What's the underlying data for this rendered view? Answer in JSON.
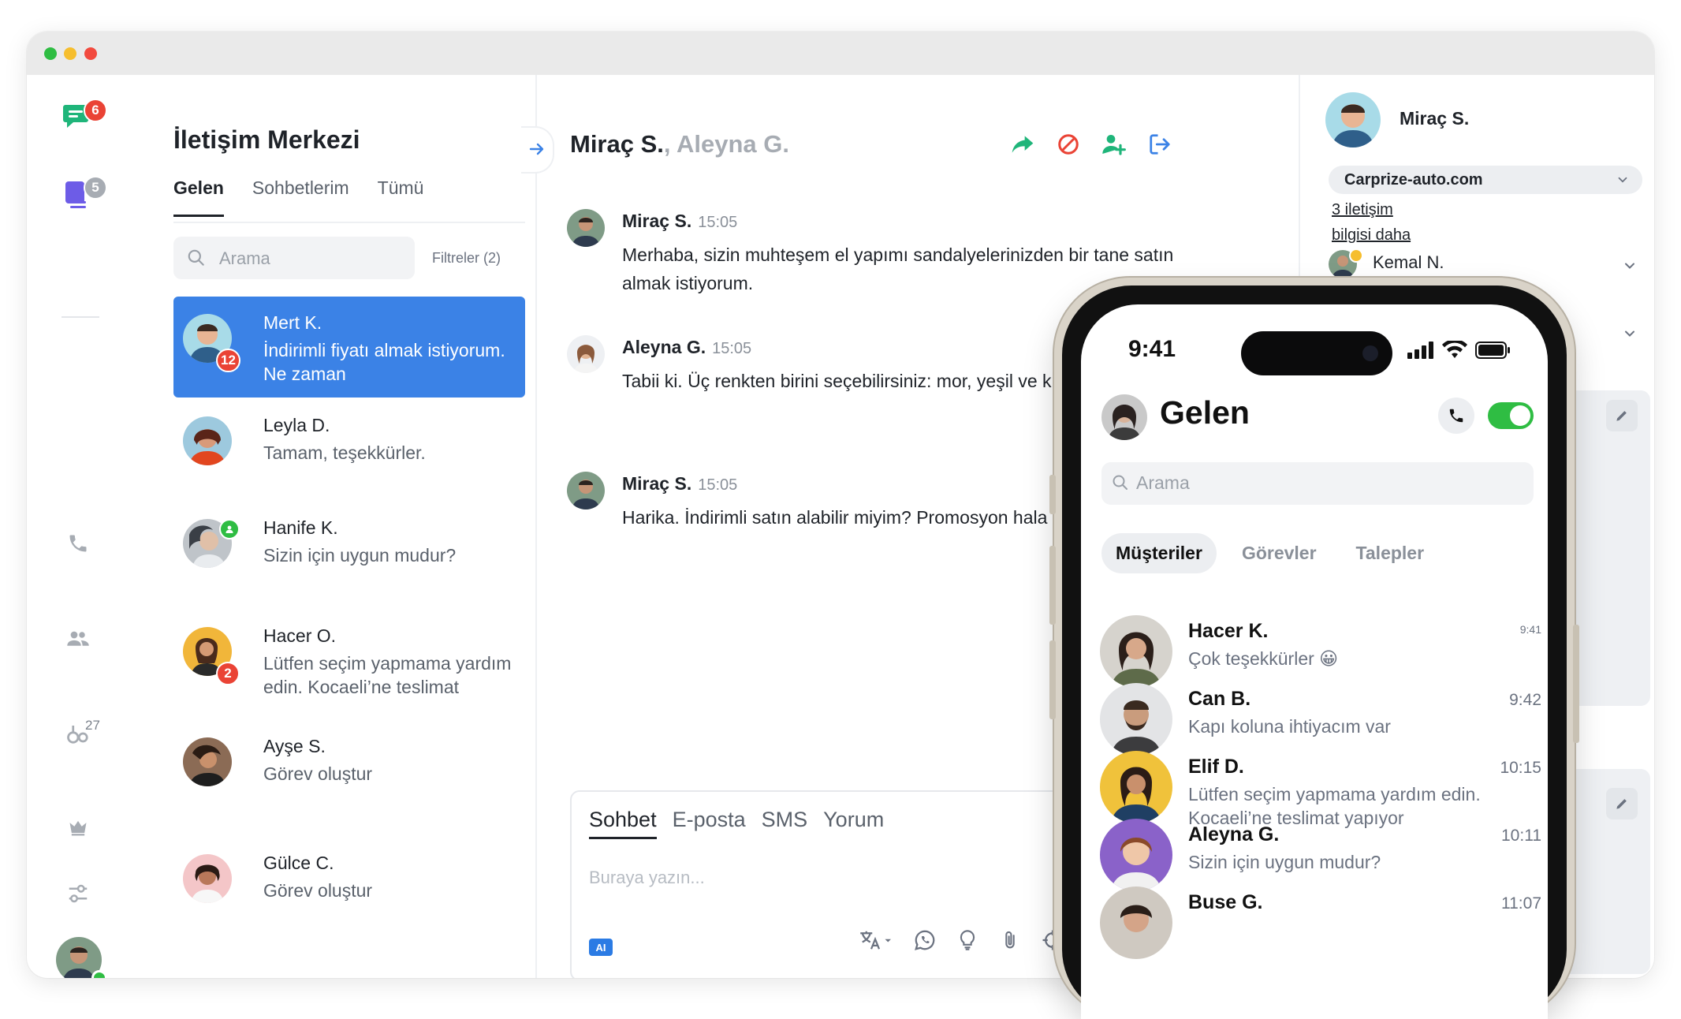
{
  "window": {
    "title_lights": [
      "close",
      "minimize",
      "zoom"
    ]
  },
  "rail": {
    "items": [
      {
        "icon": "chat-bubbles-icon",
        "badge": "6",
        "badge_color": "#ea4335"
      },
      {
        "icon": "tasks-icon",
        "badge": "5",
        "badge_color": "#a7acb3"
      },
      {
        "icon": "phone-icon"
      },
      {
        "icon": "users-icon"
      },
      {
        "icon": "wrench-icon",
        "count": "27"
      },
      {
        "icon": "crown-icon"
      },
      {
        "icon": "sliders-icon"
      }
    ]
  },
  "list": {
    "title": "İletişim Merkezi",
    "tabs": [
      "Gelen",
      "Sohbetlerim",
      "Tümü"
    ],
    "active_tab": "Gelen",
    "search_placeholder": "Arama",
    "filters_label": "Filtreler (2)",
    "contacts": [
      {
        "name": "Mert K.",
        "message": "İndirimli fiyatı almak istiyorum. Ne zaman",
        "badge": "12",
        "active": true
      },
      {
        "name": "Leyla D.",
        "message": "Tamam, teşekkürler."
      },
      {
        "name": "Hanife K.",
        "message": "Sizin için uygun mudur?"
      },
      {
        "name": "Hacer O.",
        "message": "Lütfen seçim yapmama yardım edin. Kocaeli’ne teslimat yapıyor musunuz?",
        "badge": "2"
      },
      {
        "name": "Ayşe S.",
        "message": "Görev oluştur"
      },
      {
        "name": "Gülce C.",
        "message": "Görev oluştur"
      }
    ]
  },
  "chat": {
    "header_primary": "Miraç S.",
    "header_separator": ",",
    "header_secondary": "Aleyna G.",
    "messages": [
      {
        "name": "Miraç S.",
        "time": "15:05",
        "text": "Merhaba, sizin muhteşem el yapımı sandalyelerinizden bir tane satın almak istiyorum."
      },
      {
        "name": "Aleyna G.",
        "time": "15:05",
        "text": "Tabii ki. Üç renkten birini seçebilirsiniz: mor, yeşil ve kızılcık kırmızısı."
      },
      {
        "name": "Miraç S.",
        "time": "15:05",
        "text": "Harika. İndirimli satın alabilir miyim? Promosyon hala"
      }
    ],
    "composer": {
      "tabs": [
        "Sohbet",
        "E-posta",
        "SMS",
        "Yorum"
      ],
      "active_tab": "Sohbet",
      "placeholder": "Buraya yazın...",
      "ai_label": "AI"
    }
  },
  "sidebar": {
    "contact_name": "Miraç S.",
    "company": "Carprize-auto.com",
    "link1": "3 iletişim",
    "link2": "bilgisi daha",
    "agent": "Kemal N."
  },
  "phone": {
    "time": "9:41",
    "title": "Gelen",
    "search_placeholder": "Arama",
    "tabs": [
      "Müşteriler",
      "Görevler",
      "Talepler"
    ],
    "active_tab": "Müşteriler",
    "items": [
      {
        "name": "Hacer K.",
        "message": "Çok teşekkürler 😀",
        "time": "9:41"
      },
      {
        "name": "Can B.",
        "message": "Kapı koluna ihtiyacım var",
        "time": "9:42"
      },
      {
        "name": "Elif D.",
        "message": "Lütfen seçim yapmama yardım edin. Kocaeli’ne teslimat yapıyor musunuz?",
        "time": "10:15"
      },
      {
        "name": "Aleyna G.",
        "message": "Sizin için uygun mudur?",
        "time": "10:11"
      },
      {
        "name": "Buse G.",
        "message": "",
        "time": "11:07"
      }
    ]
  },
  "colors": {
    "accent": "#3b82e6",
    "brand_green": "#1fb57a",
    "brand_purple": "#6d5ce7",
    "badge_red": "#ea4335",
    "toggle_green": "#2fbd43"
  }
}
